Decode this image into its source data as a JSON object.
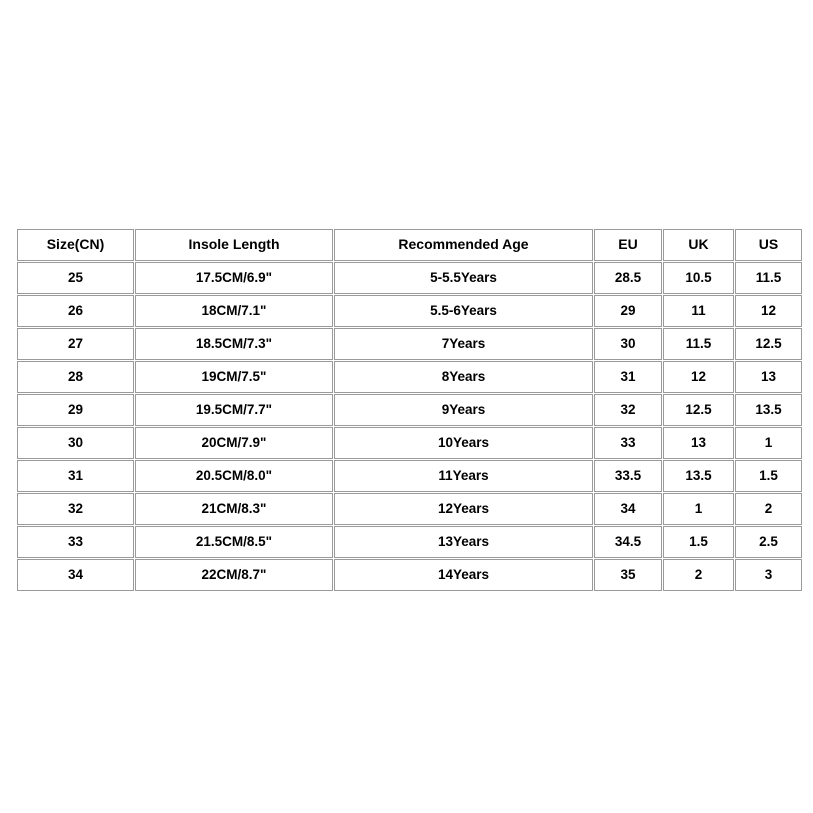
{
  "table": {
    "name": "shoe-size-chart",
    "border_color": "#9a9a9a",
    "text_color": "#000000",
    "background": "#ffffff",
    "columns": [
      {
        "key": "size_cn",
        "label": "Size(CN)"
      },
      {
        "key": "insole_length",
        "label": "Insole Length"
      },
      {
        "key": "recommended_age",
        "label": "Recommended Age"
      },
      {
        "key": "eu",
        "label": "EU"
      },
      {
        "key": "uk",
        "label": "UK"
      },
      {
        "key": "us",
        "label": "US"
      }
    ],
    "rows": [
      {
        "size_cn": "25",
        "insole_length": "17.5CM/6.9\"",
        "recommended_age": "5-5.5Years",
        "eu": "28.5",
        "uk": "10.5",
        "us": "11.5"
      },
      {
        "size_cn": "26",
        "insole_length": "18CM/7.1\"",
        "recommended_age": "5.5-6Years",
        "eu": "29",
        "uk": "11",
        "us": "12"
      },
      {
        "size_cn": "27",
        "insole_length": "18.5CM/7.3\"",
        "recommended_age": "7Years",
        "eu": "30",
        "uk": "11.5",
        "us": "12.5"
      },
      {
        "size_cn": "28",
        "insole_length": "19CM/7.5\"",
        "recommended_age": "8Years",
        "eu": "31",
        "uk": "12",
        "us": "13"
      },
      {
        "size_cn": "29",
        "insole_length": "19.5CM/7.7\"",
        "recommended_age": "9Years",
        "eu": "32",
        "uk": "12.5",
        "us": "13.5"
      },
      {
        "size_cn": "30",
        "insole_length": "20CM/7.9\"",
        "recommended_age": "10Years",
        "eu": "33",
        "uk": "13",
        "us": "1"
      },
      {
        "size_cn": "31",
        "insole_length": "20.5CM/8.0\"",
        "recommended_age": "11Years",
        "eu": "33.5",
        "uk": "13.5",
        "us": "1.5"
      },
      {
        "size_cn": "32",
        "insole_length": "21CM/8.3\"",
        "recommended_age": "12Years",
        "eu": "34",
        "uk": "1",
        "us": "2"
      },
      {
        "size_cn": "33",
        "insole_length": "21.5CM/8.5\"",
        "recommended_age": "13Years",
        "eu": "34.5",
        "uk": "1.5",
        "us": "2.5"
      },
      {
        "size_cn": "34",
        "insole_length": "22CM/8.7\"",
        "recommended_age": "14Years",
        "eu": "35",
        "uk": "2",
        "us": "3"
      }
    ]
  }
}
